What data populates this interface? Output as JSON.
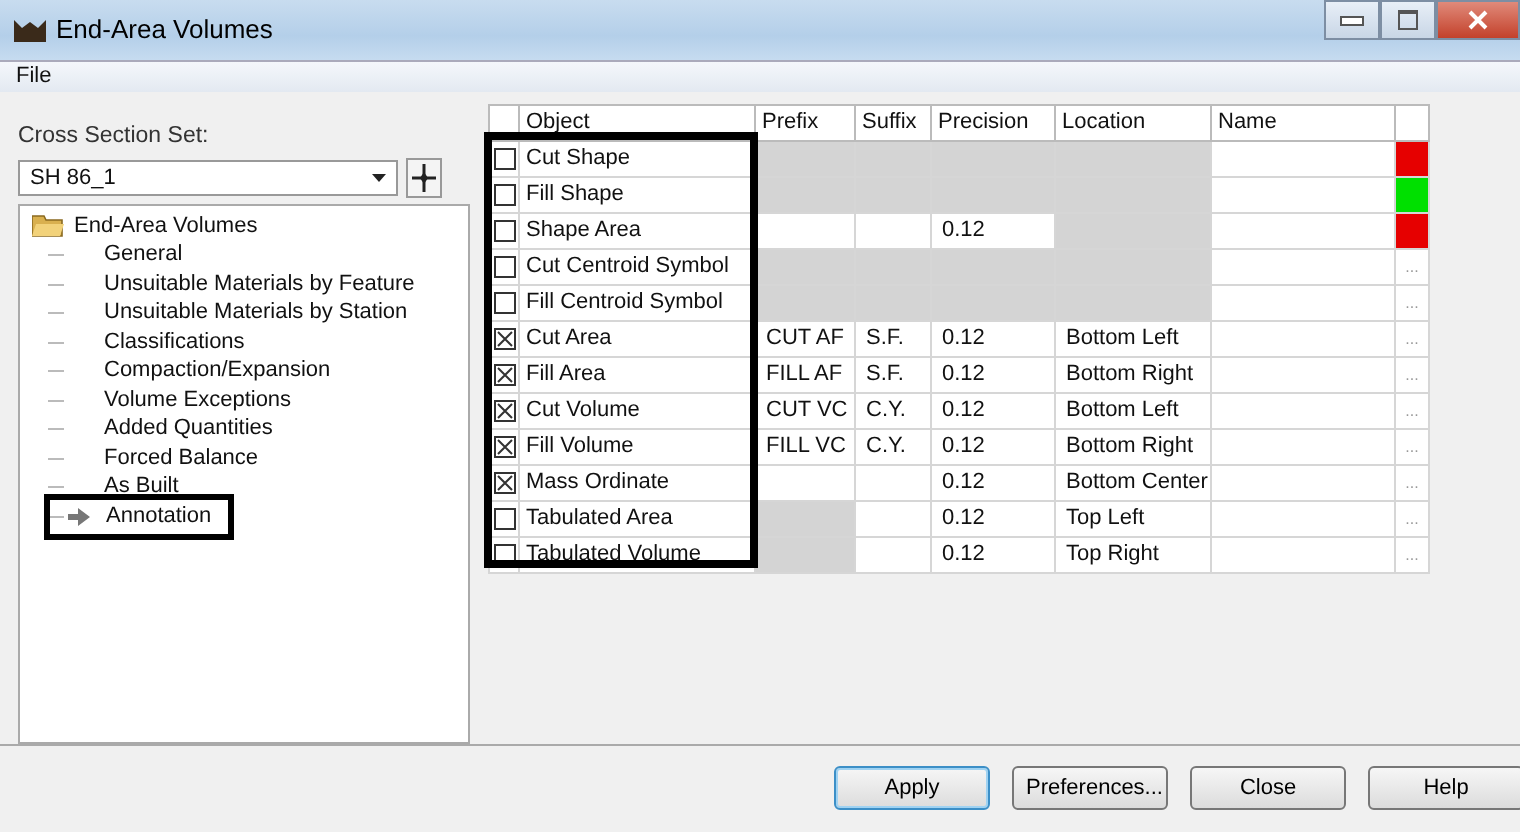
{
  "window": {
    "title": "End-Area Volumes"
  },
  "menu": [
    "File"
  ],
  "cross_section_set": {
    "label": "Cross Section Set:",
    "value": "SH 86_1"
  },
  "tree": {
    "label": "End-Area Volumes",
    "expanded": true,
    "children": [
      {
        "label": "General",
        "highlighted": false,
        "current": false
      },
      {
        "label": "Unsuitable Materials by Feature",
        "highlighted": false,
        "current": false
      },
      {
        "label": "Unsuitable Materials by Station",
        "highlighted": false,
        "current": false
      },
      {
        "label": "Classifications",
        "highlighted": false,
        "current": false
      },
      {
        "label": "Compaction/Expansion",
        "highlighted": false,
        "current": false
      },
      {
        "label": "Volume Exceptions",
        "highlighted": false,
        "current": false
      },
      {
        "label": "Added Quantities",
        "highlighted": false,
        "current": false
      },
      {
        "label": "Forced Balance",
        "highlighted": false,
        "current": false
      },
      {
        "label": "As Built",
        "highlighted": false,
        "current": false
      },
      {
        "label": "Annotation",
        "highlighted": true,
        "current": true
      }
    ]
  },
  "table": {
    "object_column_highlighted": true,
    "columns": [
      "Object",
      "Prefix",
      "Suffix",
      "Precision",
      "Location",
      "Name"
    ],
    "rows": [
      {
        "cells": [
          {
            "text": "Cut Shape",
            "checked": false
          },
          {
            "disabled": true
          },
          {
            "disabled": true
          },
          {
            "disabled": true
          },
          {
            "disabled": true
          },
          {
            "disabled": false
          }
        ],
        "end": {
          "kind": "color",
          "color": "#e60000"
        }
      },
      {
        "cells": [
          {
            "text": "Fill Shape",
            "checked": false
          },
          {
            "disabled": true
          },
          {
            "disabled": true
          },
          {
            "disabled": true
          },
          {
            "disabled": true
          },
          {
            "disabled": false
          }
        ],
        "end": {
          "kind": "color",
          "color": "#00e000"
        }
      },
      {
        "cells": [
          {
            "text": "Shape Area",
            "checked": false
          },
          {
            "disabled": false
          },
          {
            "disabled": false
          },
          {
            "text": "0.12",
            "disabled": false
          },
          {
            "disabled": true
          },
          {
            "disabled": false
          }
        ],
        "end": {
          "kind": "color",
          "color": "#e60000"
        }
      },
      {
        "cells": [
          {
            "text": "Cut Centroid Symbol",
            "checked": false
          },
          {
            "disabled": true
          },
          {
            "disabled": true
          },
          {
            "disabled": true
          },
          {
            "disabled": true
          },
          {
            "disabled": false
          }
        ],
        "end": {
          "kind": "more",
          "text": "..."
        }
      },
      {
        "cells": [
          {
            "text": "Fill Centroid Symbol",
            "checked": false
          },
          {
            "disabled": true
          },
          {
            "disabled": true
          },
          {
            "disabled": true
          },
          {
            "disabled": true
          },
          {
            "disabled": false
          }
        ],
        "end": {
          "kind": "more",
          "text": "..."
        }
      },
      {
        "cells": [
          {
            "text": "Cut Area",
            "checked": true
          },
          {
            "text": "CUT AF",
            "disabled": false
          },
          {
            "text": "S.F.",
            "disabled": false
          },
          {
            "text": "0.12",
            "disabled": false
          },
          {
            "text": "Bottom Left",
            "disabled": false
          },
          {
            "disabled": false
          }
        ],
        "end": {
          "kind": "more",
          "text": "..."
        }
      },
      {
        "cells": [
          {
            "text": "Fill Area",
            "checked": true
          },
          {
            "text": "FILL AF",
            "disabled": false
          },
          {
            "text": "S.F.",
            "disabled": false
          },
          {
            "text": "0.12",
            "disabled": false
          },
          {
            "text": "Bottom Right",
            "disabled": false
          },
          {
            "disabled": false
          }
        ],
        "end": {
          "kind": "more",
          "text": "..."
        }
      },
      {
        "cells": [
          {
            "text": "Cut Volume",
            "checked": true
          },
          {
            "text": "CUT VC",
            "disabled": false
          },
          {
            "text": "C.Y.",
            "disabled": false
          },
          {
            "text": "0.12",
            "disabled": false
          },
          {
            "text": "Bottom Left",
            "disabled": false
          },
          {
            "disabled": false
          }
        ],
        "end": {
          "kind": "more",
          "text": "..."
        }
      },
      {
        "cells": [
          {
            "text": "Fill Volume",
            "checked": true
          },
          {
            "text": "FILL VC",
            "disabled": false
          },
          {
            "text": "C.Y.",
            "disabled": false
          },
          {
            "text": "0.12",
            "disabled": false
          },
          {
            "text": "Bottom Right",
            "disabled": false
          },
          {
            "disabled": false
          }
        ],
        "end": {
          "kind": "more",
          "text": "..."
        }
      },
      {
        "cells": [
          {
            "text": "Mass Ordinate",
            "checked": true
          },
          {
            "disabled": false
          },
          {
            "disabled": false
          },
          {
            "text": "0.12",
            "disabled": false
          },
          {
            "text": "Bottom Center",
            "disabled": false
          },
          {
            "disabled": false
          }
        ],
        "end": {
          "kind": "more",
          "text": "..."
        }
      },
      {
        "cells": [
          {
            "text": "Tabulated Area",
            "checked": false
          },
          {
            "disabled": true
          },
          {
            "disabled": false
          },
          {
            "text": "0.12",
            "disabled": false
          },
          {
            "text": "Top Left",
            "disabled": false
          },
          {
            "disabled": false
          }
        ],
        "end": {
          "kind": "more",
          "text": "..."
        }
      },
      {
        "cells": [
          {
            "text": "Tabulated Volume",
            "checked": false
          },
          {
            "disabled": true
          },
          {
            "disabled": false
          },
          {
            "text": "0.12",
            "disabled": false
          },
          {
            "text": "Top Right",
            "disabled": false
          },
          {
            "disabled": false
          }
        ],
        "end": {
          "kind": "more",
          "text": "..."
        }
      }
    ]
  },
  "buttons": [
    {
      "label": "Apply",
      "default": true
    },
    {
      "label": "Preferences...",
      "default": false
    },
    {
      "label": "Close",
      "default": false
    },
    {
      "label": "Help",
      "default": false
    }
  ]
}
